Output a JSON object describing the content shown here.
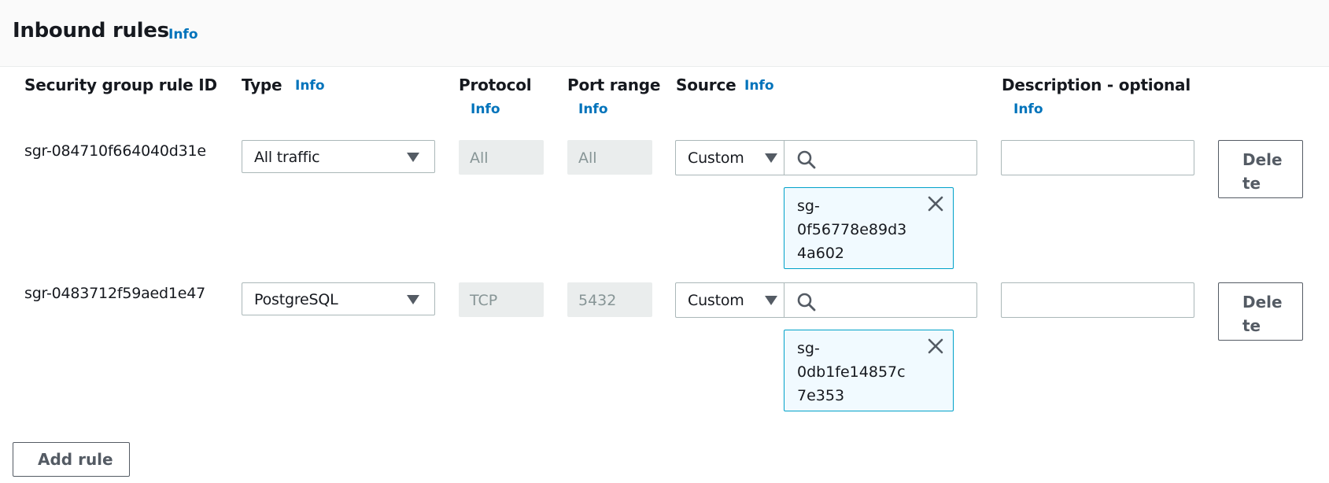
{
  "header": {
    "title": "Inbound rules",
    "info": "Info"
  },
  "columns": {
    "rule_id": "Security group rule ID",
    "type": "Type",
    "type_info": "Info",
    "protocol": "Protocol",
    "protocol_info": "Info",
    "port_range": "Port range",
    "port_range_info": "Info",
    "source": "Source",
    "source_info": "Info",
    "description": "Description - optional",
    "description_info": "Info"
  },
  "rules": [
    {
      "id": "sgr-084710f664040d31e",
      "type": "All traffic",
      "protocol": "All",
      "port_range": "All",
      "source_type": "Custom",
      "search_value": "",
      "token_lines": [
        "sg-",
        "0f56778e89d3",
        "4a602"
      ],
      "description": "",
      "delete_lines": [
        "Dele",
        "te"
      ]
    },
    {
      "id": "sgr-0483712f59aed1e47",
      "type": "PostgreSQL",
      "protocol": "TCP",
      "port_range": "5432",
      "source_type": "Custom",
      "search_value": "",
      "token_lines": [
        "sg-",
        "0db1fe14857c",
        "7e353"
      ],
      "description": "",
      "delete_lines": [
        "Dele",
        "te"
      ]
    }
  ],
  "add_rule_label": "Add rule",
  "icons": {
    "caret": "caret-down-icon",
    "search": "search-icon",
    "remove": "close-icon"
  },
  "colors": {
    "link": "#0073bb",
    "token_border": "#00a1c9",
    "token_bg": "#f1faff",
    "disabled_bg": "#eaeded",
    "header_bg": "#fafafa"
  }
}
